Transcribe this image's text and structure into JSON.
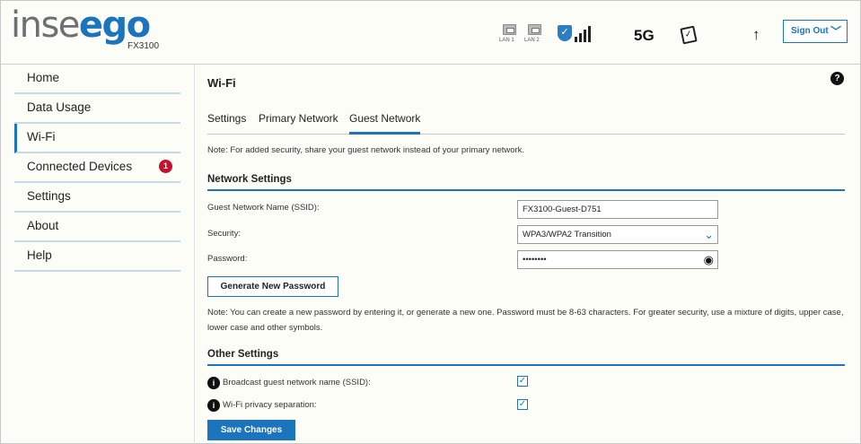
{
  "header": {
    "logo_part1": "inse",
    "logo_part2": "ego",
    "model": "FX3100",
    "lan1_label": "LAN 1",
    "lan2_label": "LAN 2",
    "network_type": "5G",
    "upload_arrow": "↑",
    "sign_out_label": "Sign Out"
  },
  "sidebar": {
    "items": [
      {
        "label": "Home"
      },
      {
        "label": "Data Usage"
      },
      {
        "label": "Wi-Fi"
      },
      {
        "label": "Connected Devices",
        "badge": "1"
      },
      {
        "label": "Settings"
      },
      {
        "label": "About"
      },
      {
        "label": "Help"
      }
    ],
    "active_index": 2
  },
  "main": {
    "title": "Wi-Fi",
    "help_icon": "?",
    "tabs": [
      {
        "label": "Settings"
      },
      {
        "label": "Primary Network"
      },
      {
        "label": "Guest Network"
      }
    ],
    "active_tab": 2,
    "note_top": "Note: For added security, share your guest network instead of your primary network.",
    "network_settings": {
      "heading": "Network Settings",
      "ssid_label": "Guest Network Name (SSID):",
      "ssid_value": "FX3100-Guest-D751",
      "security_label": "Security:",
      "security_value": "WPA3/WPA2 Transition",
      "password_label": "Password:",
      "password_value": "••••••••",
      "generate_button": "Generate New Password",
      "note": "Note: You can create a new password by entering it, or generate a new one. Password must be 8-63 characters. For greater security, use a mixture of digits, upper case, lower case and other symbols."
    },
    "other_settings": {
      "heading": "Other Settings",
      "broadcast_label": "Broadcast guest network name (SSID):",
      "broadcast_checked": true,
      "privacy_label": "Wi-Fi privacy separation:",
      "privacy_checked": true
    },
    "save_button": "Save Changes"
  },
  "colors": {
    "accent": "#1c75bc",
    "badge": "#c8102e",
    "background": "#fdfdf7"
  }
}
